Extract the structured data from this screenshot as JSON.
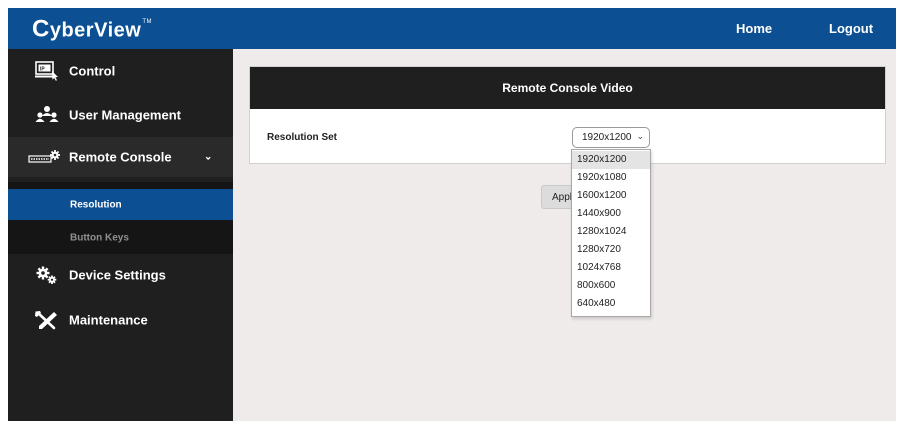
{
  "header": {
    "brand_initial": "C",
    "brand_rest": "yberView",
    "brand_tm": "TM",
    "nav_home": "Home",
    "nav_logout": "Logout",
    "color": "#0c4f92"
  },
  "sidebar": {
    "items": [
      {
        "label": "Control",
        "icon": "monitor-cursor-icon"
      },
      {
        "label": "User Management",
        "icon": "users-icon"
      },
      {
        "label": "Remote Console",
        "icon": "keyboard-gear-icon",
        "expanded": true
      },
      {
        "label": "Device Settings",
        "icon": "gears-icon"
      },
      {
        "label": "Maintenance",
        "icon": "tools-icon"
      }
    ],
    "remote_console_sub": [
      {
        "label": "Resolution",
        "active": true
      },
      {
        "label": "Button Keys",
        "active": false
      }
    ],
    "chevron": "⌄"
  },
  "main": {
    "panel_title": "Remote Console Video",
    "resolution_label": "Resolution Set",
    "resolution_value": "1920x1200",
    "apply_label": "Apply",
    "dropdown_options": [
      "1920x1200",
      "1920x1080",
      "1600x1200",
      "1440x900",
      "1280x1024",
      "1280x720",
      "1024x768",
      "800x600",
      "640x480"
    ],
    "dropdown_highlighted": "1920x1200"
  }
}
